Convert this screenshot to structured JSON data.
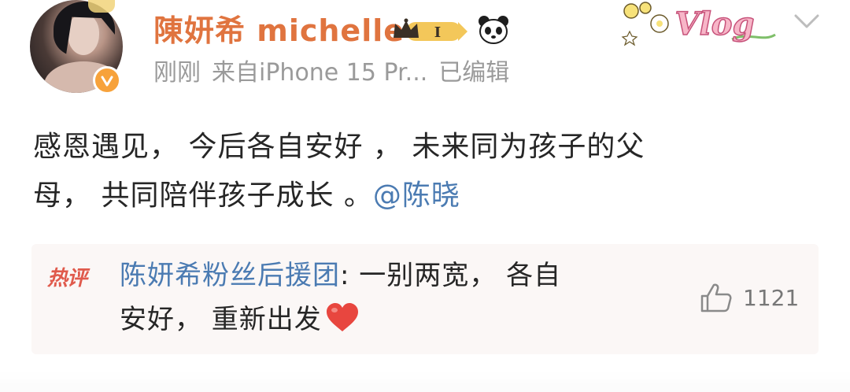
{
  "post": {
    "author": {
      "name": "陳妍希 michelle",
      "vip_level": "I",
      "verified": true
    },
    "meta": {
      "time": "刚刚",
      "source": "来自iPhone 15 Pr...",
      "edited": "已编辑"
    },
    "sticker_text": "Vlog",
    "text_line1": "感恩遇见， 今后各自安好 ， 未来同为孩子的父",
    "text_line2_start": "母， 共同陪伴孩子成长 。",
    "mention": "@陈晓"
  },
  "hot_comment": {
    "tag": "热评",
    "author": "陈妍希粉丝后援团",
    "text_line1": ": 一别两宽， 各自",
    "text_line2": "安好， 重新出发",
    "likes": "1121"
  },
  "colors": {
    "username": "#e0743f",
    "link": "#4b7bb2",
    "meta": "#9a9a9a",
    "hot_tag": "#e05a4c",
    "heart": "#e8463f"
  }
}
